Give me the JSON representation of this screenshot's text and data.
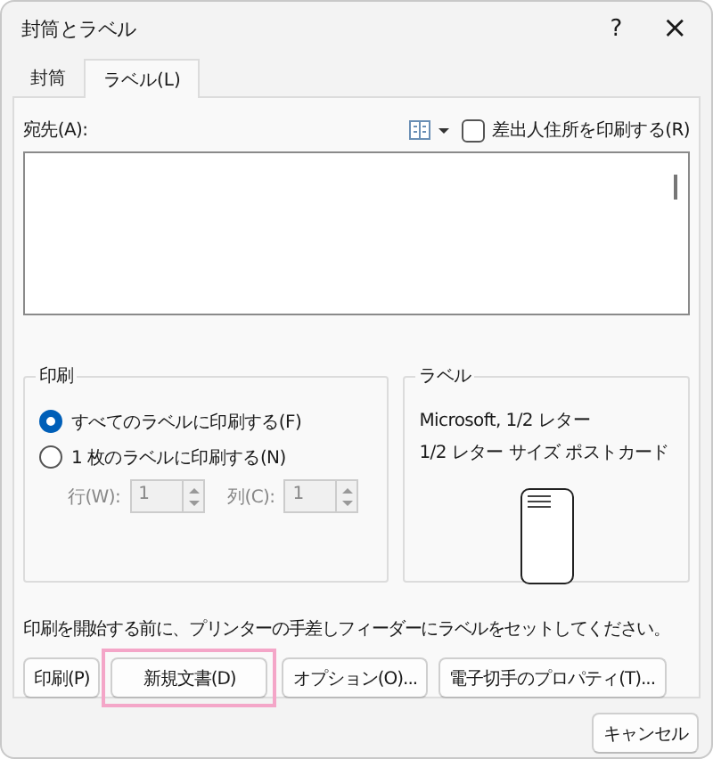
{
  "window": {
    "title": "封筒とラベル",
    "help": "?",
    "close": "×"
  },
  "tabs": [
    {
      "label": "封筒",
      "selected": false
    },
    {
      "label": "ラベル(L)",
      "selected": true
    }
  ],
  "address": {
    "label": "宛先(A):",
    "return_address": {
      "label": "差出人住所を印刷する(R)",
      "checked": false
    }
  },
  "print": {
    "title": "印刷",
    "options": [
      {
        "label": "すべてのラベルに印刷する(F)",
        "selected": true
      },
      {
        "label": "1 枚のラベルに印刷する(N)",
        "selected": false
      }
    ],
    "spinners": [
      {
        "label": "行(W):",
        "value": "1",
        "disabled": true
      },
      {
        "label": "列(C):",
        "value": "1",
        "disabled": true
      }
    ]
  },
  "label": {
    "title": "ラベル",
    "lines": [
      "Microsoft, 1/2 レター",
      "1/2 レター サイズ ポストカード"
    ]
  },
  "message": "印刷を開始する前に、プリンターの手差しフィーダーにラベルをセットしてください。",
  "buttons": [
    {
      "label": "印刷(P)",
      "highlighted": false
    },
    {
      "label": "新規文書(D)",
      "highlighted": true
    },
    {
      "label": "オプション(O)...",
      "highlighted": false
    },
    {
      "label": "電子切手のプロパティ(T)...",
      "highlighted": false
    }
  ],
  "cancel": {
    "label": "キャンセル"
  }
}
